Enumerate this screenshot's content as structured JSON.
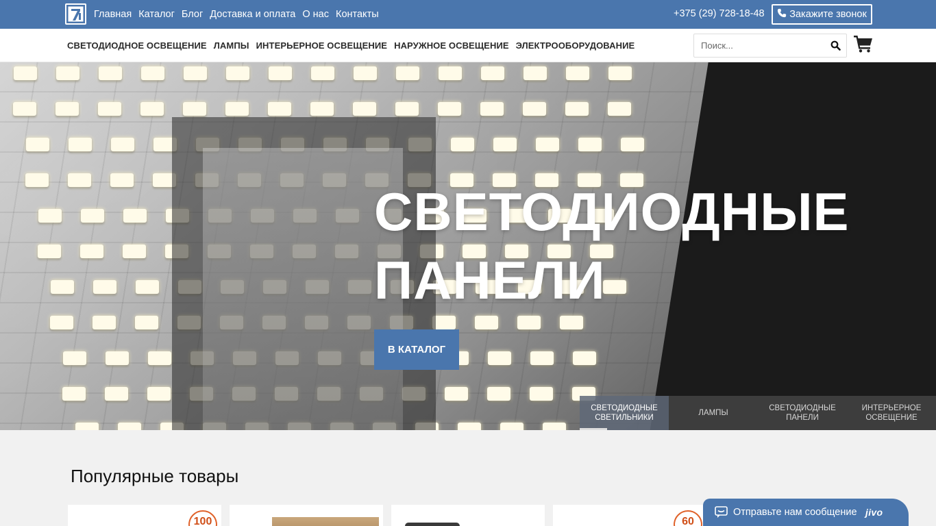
{
  "header": {
    "nav": [
      "Главная",
      "Каталог",
      "Блог",
      "Доставка и оплата",
      "О нас",
      "Контакты"
    ],
    "phone": "+375 (29) 728-18-48",
    "call_button": "Закажите звонок"
  },
  "categories": [
    "СВЕТОДИОДНОЕ ОСВЕЩЕНИЕ",
    "ЛАМПЫ",
    "ИНТЕРЬЕРНОЕ ОСВЕЩЕНИЕ",
    "НАРУЖНОЕ ОСВЕЩЕНИЕ",
    "ЭЛЕКТРООБОРУДОВАНИЕ"
  ],
  "search": {
    "placeholder": "Поиск..."
  },
  "hero": {
    "title_line1": "СВЕТОДИОДНЫЕ",
    "title_line2": "ПАНЕЛИ",
    "button": "В КАТАЛОГ",
    "tabs": [
      {
        "label": "СВЕТОДИОДНЫЕ СВЕТИЛЬНИКИ",
        "active": true
      },
      {
        "label": "ЛАМПЫ",
        "active": false
      },
      {
        "label": "СВЕТОДИОДНЫЕ ПАНЕЛИ",
        "active": false
      },
      {
        "label": "ИНТЕРЬЕРНОЕ ОСВЕЩЕНИЕ",
        "active": false
      }
    ]
  },
  "popular": {
    "title": "Популярные товары",
    "badges": [
      "100",
      "60"
    ]
  },
  "chat": {
    "text": "Отправьте нам сообщение",
    "brand": "jivo"
  },
  "colors": {
    "brand_blue": "#4a76ad",
    "badge_orange": "#e0622a"
  },
  "icons": [
    "logo-icon",
    "phone-icon",
    "search-icon",
    "cart-icon",
    "chat-icon"
  ]
}
